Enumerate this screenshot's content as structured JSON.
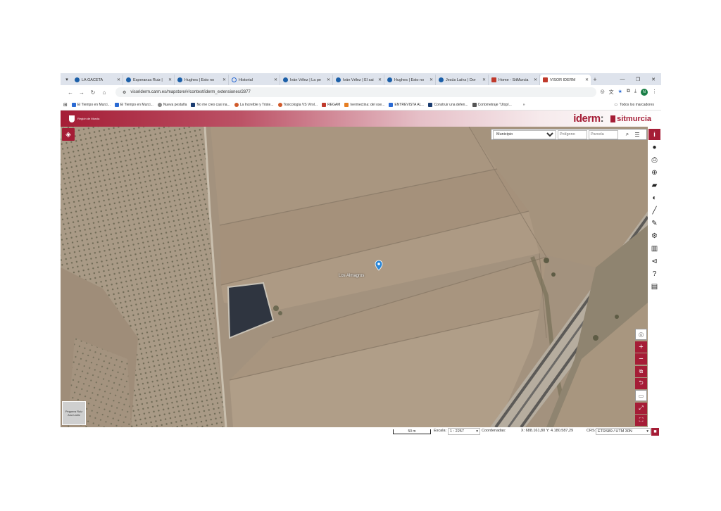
{
  "browser": {
    "tabs": [
      {
        "label": "LA GACETA",
        "icon": "newspaper-icon"
      },
      {
        "label": "Esperanza Ruiz |",
        "icon": "site-icon"
      },
      {
        "label": "Hughes | Esto no",
        "icon": "site-icon"
      },
      {
        "label": "Historial",
        "icon": "history-icon"
      },
      {
        "label": "Iván Vélez | La pe",
        "icon": "site-icon"
      },
      {
        "label": "Iván Vélez | El sai",
        "icon": "site-icon"
      },
      {
        "label": "Hughes | Esto no",
        "icon": "site-icon"
      },
      {
        "label": "Jesús Laínz | Dor",
        "icon": "site-icon"
      },
      {
        "label": "Home - SitMurcia",
        "icon": "map-icon"
      },
      {
        "label": "VISOR IDERM",
        "icon": "map-icon",
        "active": true
      }
    ],
    "url": "visoriderm.carm.es/mapstore/#/context/iderm_extensiones/2877",
    "avatar_letter": "N",
    "bookmarks": [
      "El Tiempo en Murci...",
      "El Tiempo en Murci...",
      "Nueva pestaña",
      "No me creo casi na...",
      "La Increíble y Triste...",
      "Toxicología VS Virol...",
      "REGAM",
      "Ivermectina: del ose...",
      "ENTREVISTA AL...",
      "Construir una defen...",
      "Cortometraje \"Utopí..."
    ],
    "all_bookmarks": "Todos los marcadores"
  },
  "app": {
    "crest_text": "Región de Murcia",
    "logo_iderm": "iderm",
    "logo_sit": "sitmurcia"
  },
  "search": {
    "municipio": "Municipio",
    "poligono_placeholder": "Polígono",
    "parcela_placeholder": "Parcela"
  },
  "map": {
    "marker_label": "Los Almagros",
    "minimap_label": "Peppera Ruiz Ana Lahiz"
  },
  "status": {
    "scale_bar": "50 m",
    "escala_label": "Escala:",
    "escala_value": "1 : 2257",
    "coords_label": "Coordenadas:",
    "coords_value": "X: 688.161,80 Y: 4.180.587,29",
    "crs_label": "CRS:",
    "crs_value": "ETRS89 / UTM 30N"
  },
  "colors": {
    "accent": "#a51d36",
    "field": "#a3927e"
  }
}
